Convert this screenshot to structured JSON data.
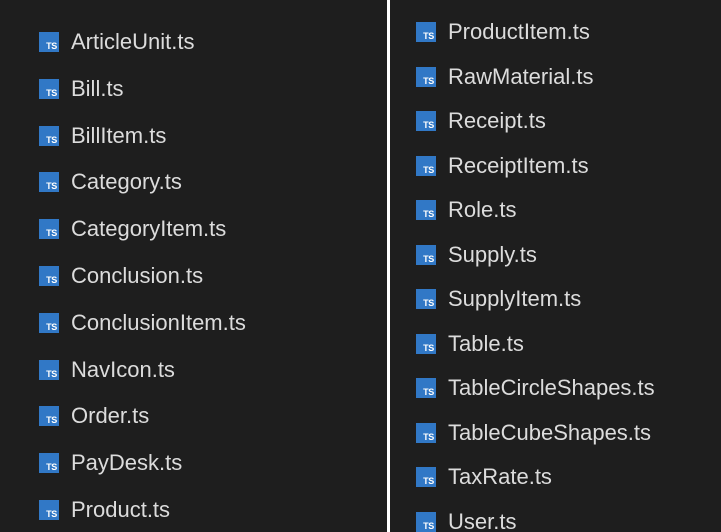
{
  "explorer": {
    "icon_text": "TS",
    "icon_color": "#3178c6",
    "background_color": "#1e1e1e",
    "left_column": [
      {
        "name": "ArticleUnit.ts",
        "icon": "typescript-file-icon"
      },
      {
        "name": "Bill.ts",
        "icon": "typescript-file-icon"
      },
      {
        "name": "BillItem.ts",
        "icon": "typescript-file-icon"
      },
      {
        "name": "Category.ts",
        "icon": "typescript-file-icon"
      },
      {
        "name": "CategoryItem.ts",
        "icon": "typescript-file-icon"
      },
      {
        "name": "Conclusion.ts",
        "icon": "typescript-file-icon"
      },
      {
        "name": "ConclusionItem.ts",
        "icon": "typescript-file-icon"
      },
      {
        "name": "NavIcon.ts",
        "icon": "typescript-file-icon"
      },
      {
        "name": "Order.ts",
        "icon": "typescript-file-icon"
      },
      {
        "name": "PayDesk.ts",
        "icon": "typescript-file-icon"
      },
      {
        "name": "Product.ts",
        "icon": "typescript-file-icon"
      }
    ],
    "right_column": [
      {
        "name": "ProductItem.ts",
        "icon": "typescript-file-icon"
      },
      {
        "name": "RawMaterial.ts",
        "icon": "typescript-file-icon"
      },
      {
        "name": "Receipt.ts",
        "icon": "typescript-file-icon"
      },
      {
        "name": "ReceiptItem.ts",
        "icon": "typescript-file-icon"
      },
      {
        "name": "Role.ts",
        "icon": "typescript-file-icon"
      },
      {
        "name": "Supply.ts",
        "icon": "typescript-file-icon"
      },
      {
        "name": "SupplyItem.ts",
        "icon": "typescript-file-icon"
      },
      {
        "name": "Table.ts",
        "icon": "typescript-file-icon"
      },
      {
        "name": "TableCircleShapes.ts",
        "icon": "typescript-file-icon"
      },
      {
        "name": "TableCubeShapes.ts",
        "icon": "typescript-file-icon"
      },
      {
        "name": "TaxRate.ts",
        "icon": "typescript-file-icon"
      },
      {
        "name": "User.ts",
        "icon": "typescript-file-icon"
      }
    ]
  }
}
